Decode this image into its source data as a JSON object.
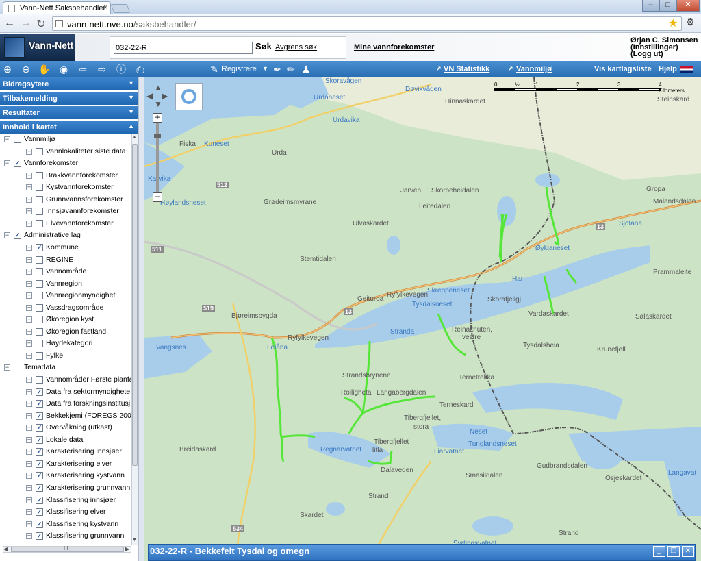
{
  "browser": {
    "tab_title": "Vann-Nett Saksbehandler",
    "tab_close": "×",
    "url_host": "vann-nett.nve.no",
    "url_path": "/saksbehandler/",
    "win_min": "–",
    "win_max": "□",
    "win_close": "✕",
    "nav_icons": [
      "back-arrow-icon",
      "forward-arrow-icon",
      "reload-icon"
    ]
  },
  "header": {
    "logo": "Vann-Nett",
    "search_value": "032-22-R",
    "search_button": "Søk",
    "refine_link": "Avgrens søk",
    "mine_link": "Mine vannforekomster",
    "user_name": "Ørjan C. Simonsen",
    "user_settings": "(Innstillinger)",
    "user_logout": "(Logg ut)"
  },
  "map_toolbar": {
    "register": "Registrere",
    "vn_stats": "VN Statistikk",
    "vannmiljo": "Vannmiljø",
    "layer_list": "Vis kartlagsliste",
    "help": "Hjelp"
  },
  "sidebar": {
    "accordions": [
      "Bidragsytere",
      "Tilbakemelding",
      "Resultater",
      "Innhold i kartet"
    ],
    "tree": [
      {
        "level": 0,
        "label": "Vannmiljø",
        "checked": false,
        "expanded": true
      },
      {
        "level": 1,
        "label": "Vannlokaliteter siste data",
        "checked": false
      },
      {
        "level": 0,
        "label": "Vannforekomster",
        "checked": true,
        "expanded": true
      },
      {
        "level": 1,
        "label": "Brakkvannforekomster",
        "checked": false
      },
      {
        "level": 1,
        "label": "Kystvannforekomster",
        "checked": false
      },
      {
        "level": 1,
        "label": "Grunnvannsforekomster",
        "checked": false
      },
      {
        "level": 1,
        "label": "Innsjøvannforekomster",
        "checked": false
      },
      {
        "level": 1,
        "label": "Elvevannforekomster",
        "checked": false
      },
      {
        "level": 0,
        "label": "Administrative lag",
        "checked": true,
        "expanded": true
      },
      {
        "level": 1,
        "label": "Kommune",
        "checked": true
      },
      {
        "level": 1,
        "label": "REGINE",
        "checked": false
      },
      {
        "level": 1,
        "label": "Vannområde",
        "checked": false
      },
      {
        "level": 1,
        "label": "Vannregion",
        "checked": false
      },
      {
        "level": 1,
        "label": "Vannregionmyndighet",
        "checked": false
      },
      {
        "level": 1,
        "label": "Vassdragsområde",
        "checked": false
      },
      {
        "level": 1,
        "label": "Økoregion kyst",
        "checked": false
      },
      {
        "level": 1,
        "label": "Økoregion fastland",
        "checked": false
      },
      {
        "level": 1,
        "label": "Høydekategori",
        "checked": false
      },
      {
        "level": 1,
        "label": "Fylke",
        "checked": false
      },
      {
        "level": 0,
        "label": "Temadata",
        "checked": false,
        "expanded": true
      },
      {
        "level": 1,
        "label": "Vannområder Første planfa",
        "checked": false
      },
      {
        "level": 1,
        "label": "Data fra sektormyndighete",
        "checked": true
      },
      {
        "level": 1,
        "label": "Data fra forskningsinstitusj",
        "checked": true
      },
      {
        "level": 1,
        "label": "Bekkekjemi (FOREGS 2008",
        "checked": true
      },
      {
        "level": 1,
        "label": "Overvåkning (utkast)",
        "checked": true
      },
      {
        "level": 1,
        "label": "Lokale data",
        "checked": true
      },
      {
        "level": 1,
        "label": "Karakterisering innsjøer",
        "checked": true
      },
      {
        "level": 1,
        "label": "Karakterisering elver",
        "checked": true
      },
      {
        "level": 1,
        "label": "Karakterisering kystvann",
        "checked": true
      },
      {
        "level": 1,
        "label": "Karakterisering grunnvann",
        "checked": true
      },
      {
        "level": 1,
        "label": "Klassifisering innsjøer",
        "checked": true
      },
      {
        "level": 1,
        "label": "Klassifisering elver",
        "checked": true
      },
      {
        "level": 1,
        "label": "Klassifisering kystvann",
        "checked": true
      },
      {
        "level": 1,
        "label": "Klassifisering grunnvann",
        "checked": true
      }
    ],
    "hscroll_grip": "III"
  },
  "map": {
    "scale_labels": [
      "0",
      "½",
      "1",
      "2",
      "3",
      "4 Kilometers"
    ],
    "labels": [
      {
        "t": "Skoravågen",
        "w": true
      },
      {
        "t": "Døvikvågen",
        "w": true
      },
      {
        "t": "Urdaneset",
        "w": true
      },
      {
        "t": "Hinnaskardet",
        "w": false
      },
      {
        "t": "Steinskard",
        "w": false
      },
      {
        "t": "Urdavika",
        "w": true
      },
      {
        "t": "Fiska",
        "w": false
      },
      {
        "t": "Kuneset",
        "w": true
      },
      {
        "t": "Urda",
        "w": false
      },
      {
        "t": "Karvika",
        "w": true
      },
      {
        "t": "512",
        "w": false
      },
      {
        "t": "Høylandsneset",
        "w": true
      },
      {
        "t": "Grødeimsmyrane",
        "w": false
      },
      {
        "t": "Jarven",
        "w": false
      },
      {
        "t": "Skorpeheidalen",
        "w": false
      },
      {
        "t": "Leitedalen",
        "w": false
      },
      {
        "t": "Gropa",
        "w": false
      },
      {
        "t": "Malandsdalen",
        "w": false
      },
      {
        "t": "Ulvaskardet",
        "w": false
      },
      {
        "t": "Sjotana",
        "w": true
      },
      {
        "t": "13",
        "w": false
      },
      {
        "t": "511",
        "w": false
      },
      {
        "t": "Stemtidalen",
        "w": false
      },
      {
        "t": "Øykjaneset",
        "w": true
      },
      {
        "t": "Prammaleite",
        "w": false
      },
      {
        "t": "Har",
        "w": true
      },
      {
        "t": "Geiturda",
        "w": false
      },
      {
        "t": "Ryfylkevegen",
        "w": false
      },
      {
        "t": "Skreppeneset",
        "w": true
      },
      {
        "t": "Skorafjellgj",
        "w": false
      },
      {
        "t": "Tysdalsnesetl",
        "w": true
      },
      {
        "t": "Vardaskardet",
        "w": false
      },
      {
        "t": "Salaskardet",
        "w": false
      },
      {
        "t": "519",
        "w": false
      },
      {
        "t": "Bjøreimsbygda",
        "w": false
      },
      {
        "t": "13",
        "w": false
      },
      {
        "t": "Reinaknuten,",
        "w": false
      },
      {
        "t": "vestre",
        "w": false
      },
      {
        "t": "Stranda",
        "w": true
      },
      {
        "t": "Tysdalsheia",
        "w": false
      },
      {
        "t": "Krunefjell",
        "w": false
      },
      {
        "t": "Vangsnes",
        "w": true
      },
      {
        "t": "Leiåna",
        "w": true
      },
      {
        "t": "Strandsbrynene",
        "w": false
      },
      {
        "t": "Rolligheta",
        "w": false
      },
      {
        "t": "Langabergdalen",
        "w": false
      },
      {
        "t": "Ternetrekka",
        "w": false
      },
      {
        "t": "Terneskard",
        "w": false
      },
      {
        "t": "Tibergfjellet,",
        "w": false
      },
      {
        "t": "stora",
        "w": false
      },
      {
        "t": "Neset",
        "w": true
      },
      {
        "t": "Breidaskard",
        "w": false
      },
      {
        "t": "Regnarvatnet",
        "w": true
      },
      {
        "t": "Tibergfjellet",
        "w": false
      },
      {
        "t": "litla",
        "w": false
      },
      {
        "t": "Tunglandsneset",
        "w": true
      },
      {
        "t": "Liarvatnet",
        "w": true
      },
      {
        "t": "Gudbrandsdalen",
        "w": false
      },
      {
        "t": "Osjeskardet",
        "w": false
      },
      {
        "t": "Smasildalen",
        "w": false
      },
      {
        "t": "Langavat",
        "w": true
      },
      {
        "t": "Dalavegen",
        "w": false
      },
      {
        "t": "Strand",
        "w": false
      },
      {
        "t": "Skardet",
        "w": false
      },
      {
        "t": "534",
        "w": false
      },
      {
        "t": "Strand",
        "w": false
      },
      {
        "t": "Syrtingsvatnet",
        "w": true
      },
      {
        "t": "Ryfylkevegen",
        "w": false
      }
    ]
  },
  "info_window": {
    "title": "032-22-R - Bekkefelt Tysdal og omegn",
    "min": "_",
    "restore": "❐",
    "close": "✕"
  }
}
